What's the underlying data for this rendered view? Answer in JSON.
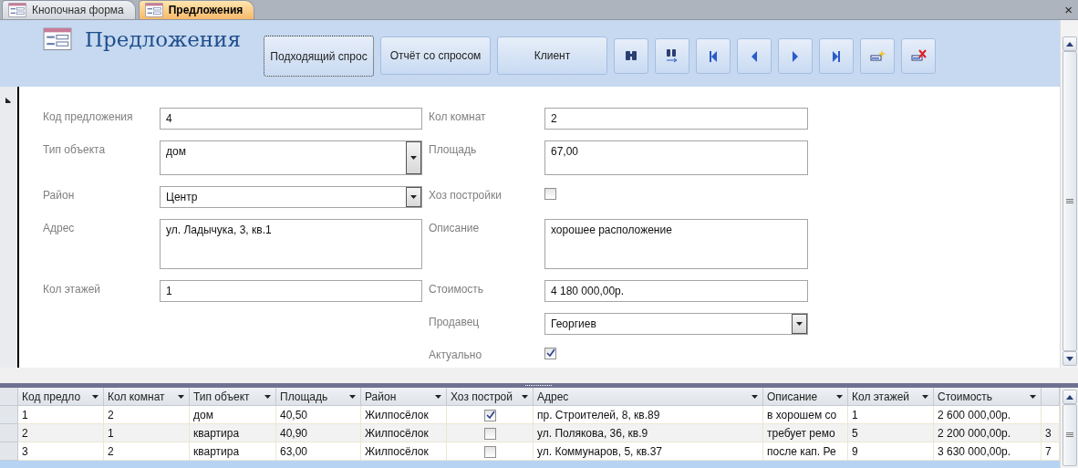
{
  "close": "×",
  "tabs": [
    {
      "label": "Кнопочная форма",
      "selected": false
    },
    {
      "label": "Предложения",
      "selected": true
    }
  ],
  "form": {
    "title": "Предложения",
    "buttons": [
      {
        "label": "Подходящий спрос",
        "focused": true
      },
      {
        "label": "Отчёт со спросом",
        "focused": false
      },
      {
        "label": "Клиент",
        "focused": false
      }
    ],
    "fields": [
      {
        "label": "Код предложения",
        "kind": "text",
        "value": "4"
      },
      {
        "label": "Кол комнат",
        "kind": "text",
        "value": "2"
      },
      {
        "label": "Тип объекта",
        "kind": "combo",
        "value": "дом"
      },
      {
        "label": "Площадь",
        "kind": "text",
        "value": "67,00"
      },
      {
        "label": "Район",
        "kind": "combo",
        "value": "Центр"
      },
      {
        "label": "Хоз постройки",
        "kind": "check",
        "checked": false
      },
      {
        "label": "Адрес",
        "kind": "text",
        "value": "ул. Ладычука, 3, кв.1"
      },
      {
        "label": "Описание",
        "kind": "text",
        "value": "хорошее расположение"
      },
      {
        "label": "Кол этажей",
        "kind": "text",
        "value": "1"
      },
      {
        "label": "Стоимость",
        "kind": "text",
        "value": "4 180 000,00р."
      },
      {
        "kind": "blank"
      },
      {
        "label": "Продавец",
        "kind": "combo",
        "value": "Георгиев"
      },
      {
        "kind": "blank"
      },
      {
        "label": "Актуально",
        "kind": "check",
        "checked": true
      }
    ]
  },
  "table": {
    "columns": [
      {
        "label": "Код предло"
      },
      {
        "label": "Кол комнат"
      },
      {
        "label": "Тип объект"
      },
      {
        "label": "Площадь"
      },
      {
        "label": "Район"
      },
      {
        "label": "Хоз построй"
      },
      {
        "label": "Адрес"
      },
      {
        "label": "Описание"
      },
      {
        "label": "Кол этажей"
      },
      {
        "label": "Стоимость"
      }
    ],
    "rows": [
      {
        "cells": [
          "1",
          "2",
          "дом",
          "40,50",
          "Жилпосёлок",
          {
            "checked": true
          },
          "пр. Строителей, 8, кв.89",
          "в хорошем со",
          "1",
          "2 600 000,00р."
        ]
      },
      {
        "cells": [
          "2",
          "1",
          "квартира",
          "40,90",
          "Жилпосёлок",
          {
            "checked": false
          },
          "ул. Полякова, 36, кв.9",
          "требует ремо",
          "5",
          "2 200 000,00р."
        ],
        "column_12": "3"
      },
      {
        "cells": [
          "3",
          "2",
          "квартира",
          "63,00",
          "Жилпосёлок",
          {
            "checked": false
          },
          "ул. Коммунаров, 5, кв.37",
          "после кап. Ре",
          "9",
          "3 630 000,00р."
        ],
        "column_12": "7"
      }
    ]
  }
}
